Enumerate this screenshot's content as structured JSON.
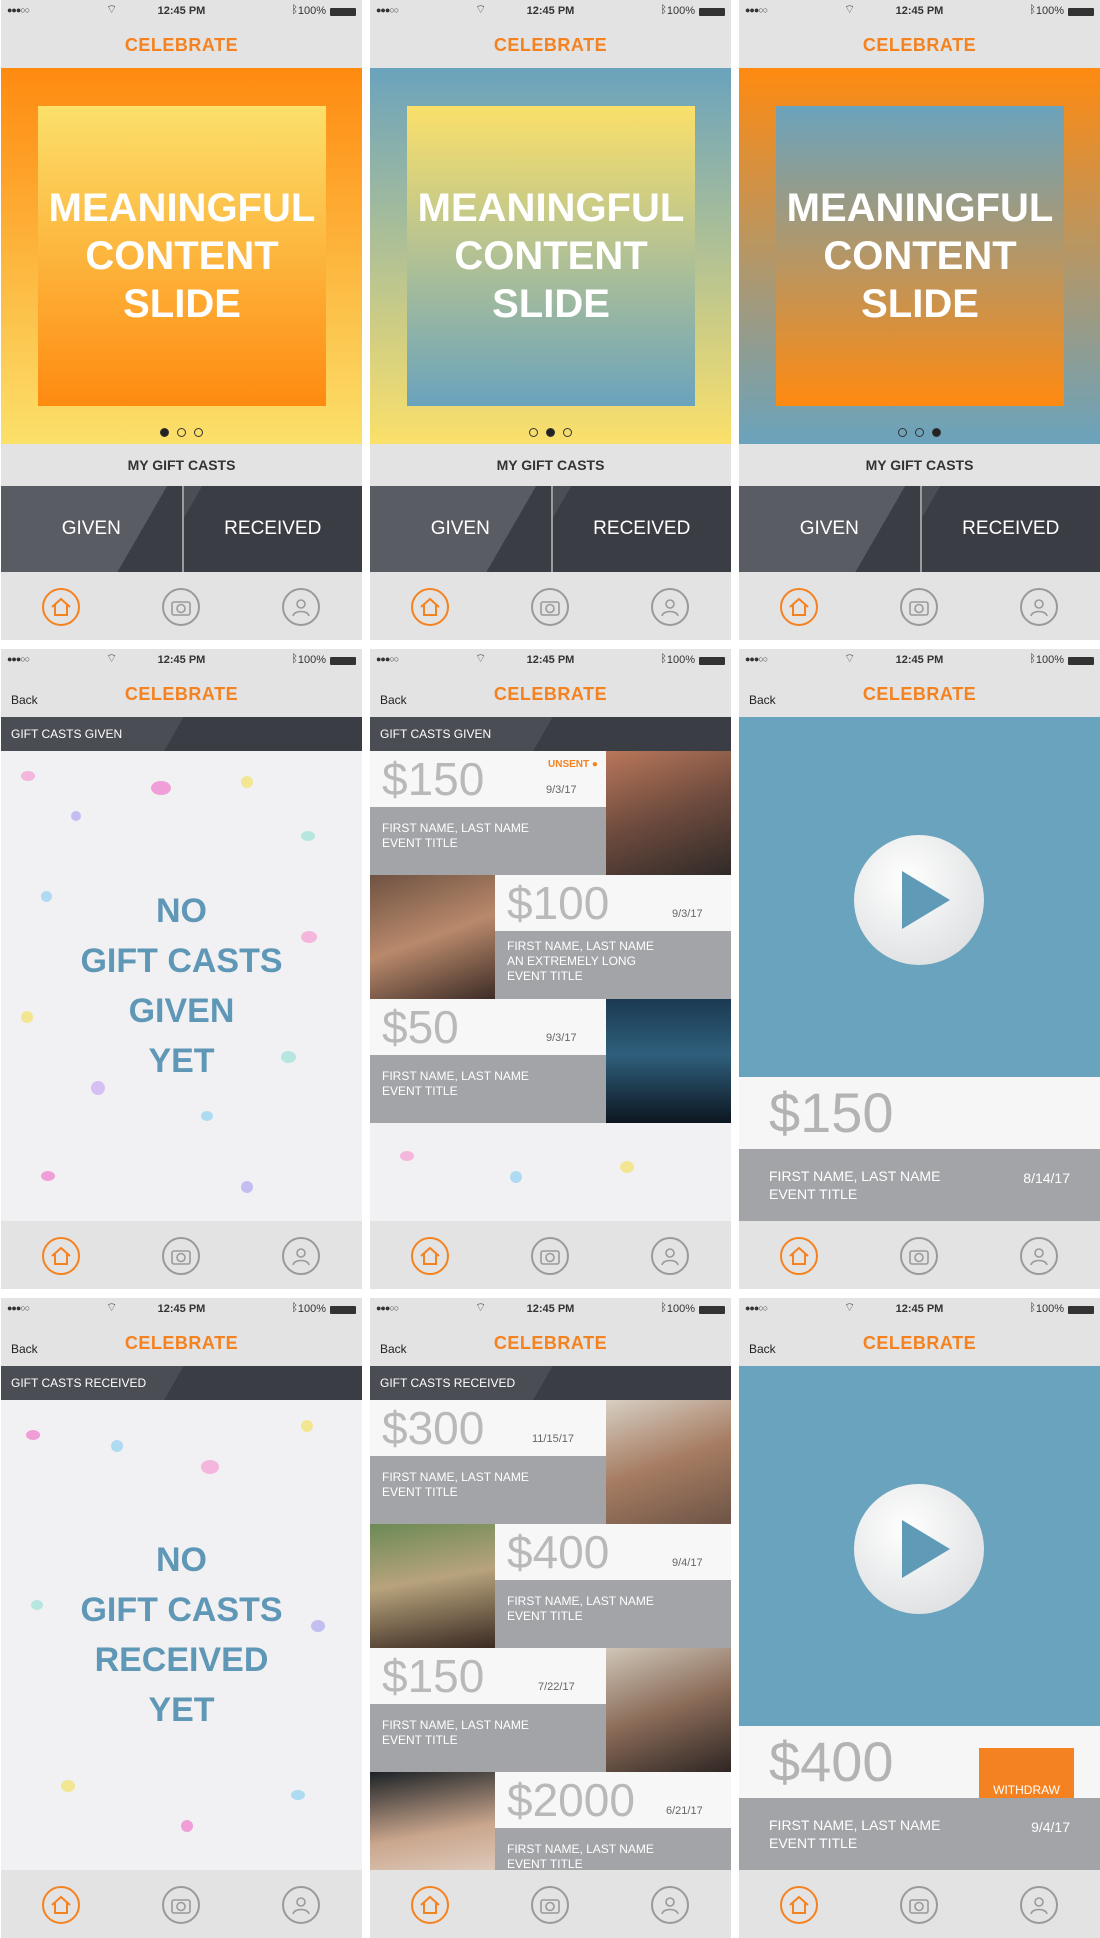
{
  "status": {
    "time": "12:45 PM",
    "battery": "100%"
  },
  "app_title": "CELEBRATE",
  "back_label": "Back",
  "slide_text": [
    "MEANINGFUL",
    "CONTENT",
    "SLIDE"
  ],
  "my_gift_casts": "MY GIFT CASTS",
  "tab_given": "GIVEN",
  "tab_received": "RECEIVED",
  "sub_given": "GIFT CASTS GIVEN",
  "sub_received": "GIFT CASTS RECEIVED",
  "empty_given": [
    "NO",
    "GIFT CASTS",
    "GIVEN",
    "YET"
  ],
  "empty_received": [
    "NO",
    "GIFT CASTS",
    "RECEIVED",
    "YET"
  ],
  "unsent": "UNSENT",
  "name_line": "FIRST NAME, LAST NAME",
  "event_line": "EVENT TITLE",
  "long_line": "AN EXTREMELY LONG",
  "given_cards": [
    {
      "amount": "$150",
      "date": "9/3/17"
    },
    {
      "amount": "$100",
      "date": "9/3/17"
    },
    {
      "amount": "$50",
      "date": "9/3/17"
    }
  ],
  "received_cards": [
    {
      "amount": "$300",
      "date": "11/15/17"
    },
    {
      "amount": "$400",
      "date": "9/4/17"
    },
    {
      "amount": "$150",
      "date": "7/22/17"
    },
    {
      "amount": "$2000",
      "date": "6/21/17"
    }
  ],
  "detail_given": {
    "amount": "$150",
    "date": "8/14/17"
  },
  "detail_received": {
    "amount": "$400",
    "date": "9/4/17",
    "withdraw": "WITHDRAW"
  },
  "colors": {
    "accent": "#f58220",
    "dark": "#3b3d45",
    "blue": "#6aa3bd",
    "yellow": "#fbe06a",
    "orange": "#ff8a10"
  }
}
